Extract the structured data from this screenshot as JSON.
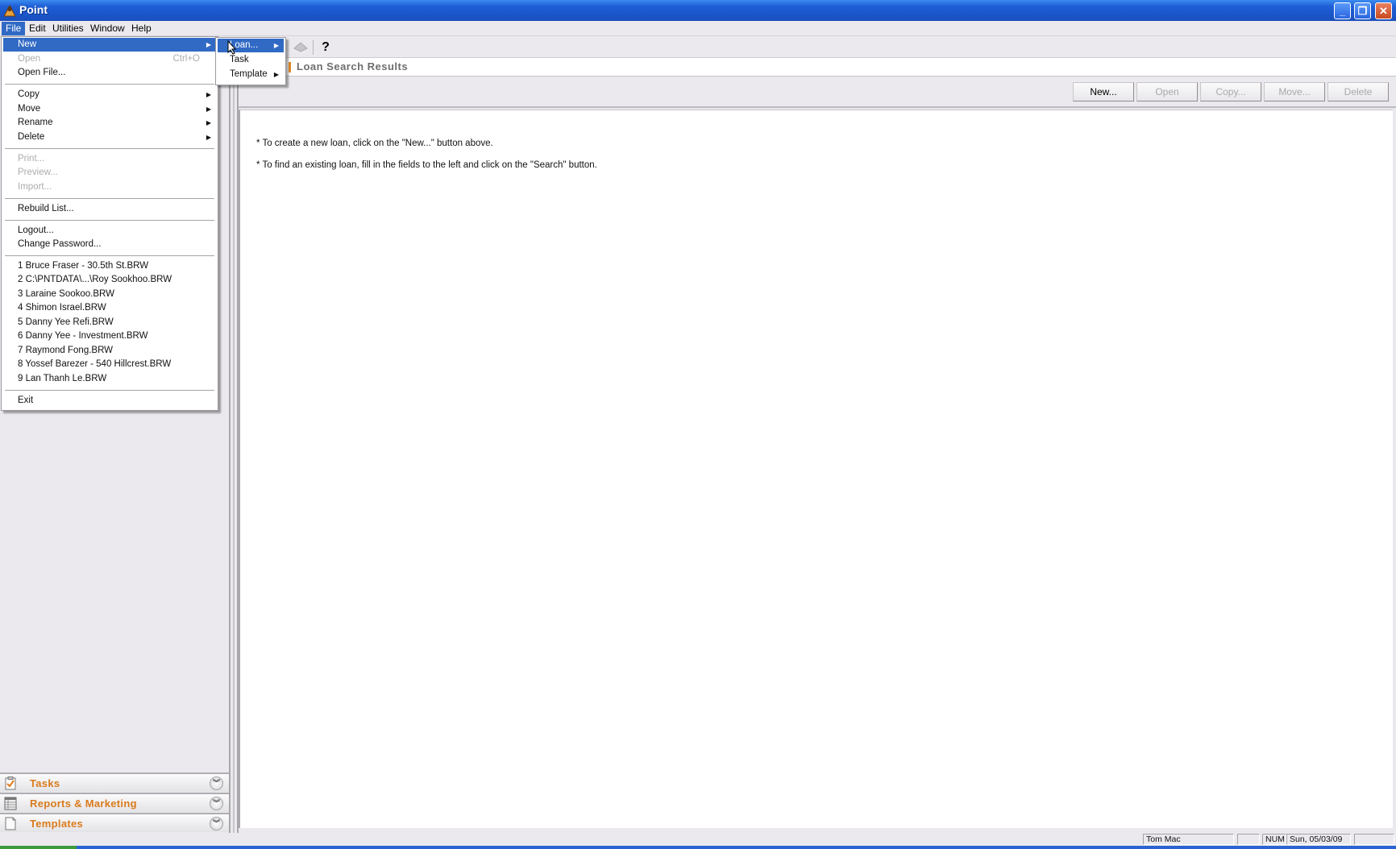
{
  "window": {
    "title": "Point",
    "controls": {
      "minimize": "_",
      "restore": "❐",
      "close": "✕"
    }
  },
  "menubar": {
    "items": [
      "File",
      "Edit",
      "Utilities",
      "Window",
      "Help"
    ],
    "active": "File"
  },
  "file_menu": {
    "new": "New",
    "open": "Open",
    "open_shortcut": "Ctrl+O",
    "open_file": "Open File...",
    "copy": "Copy",
    "move": "Move",
    "rename": "Rename",
    "delete": "Delete",
    "print": "Print...",
    "preview": "Preview...",
    "import": "Import...",
    "rebuild_list": "Rebuild List...",
    "logout": "Logout...",
    "change_password": "Change Password...",
    "recent_files": [
      "1 Bruce Fraser - 30.5th St.BRW",
      "2 C:\\PNTDATA\\...\\Roy Sookhoo.BRW",
      "3 Laraine Sookoo.BRW",
      "4 Shimon Israel.BRW",
      "5 Danny Yee Refi.BRW",
      "6 Danny Yee - Investment.BRW",
      "7 Raymond Fong.BRW",
      "8 Yossef Barezer - 540 Hillcrest.BRW",
      "9 Lan Thanh Le.BRW"
    ],
    "exit": "Exit"
  },
  "new_submenu": {
    "items": [
      "Loan...",
      "Task",
      "Template"
    ],
    "highlighted": "Loan..."
  },
  "toolbar": {
    "help_glyph": "?"
  },
  "heading": {
    "title": "Loan Search Results"
  },
  "actions": {
    "buttons": [
      {
        "label": "New...",
        "enabled": true
      },
      {
        "label": "Open",
        "enabled": false
      },
      {
        "label": "Copy...",
        "enabled": false
      },
      {
        "label": "Move...",
        "enabled": false
      },
      {
        "label": "Delete",
        "enabled": false
      }
    ]
  },
  "content": {
    "lines": [
      "* To create a new loan, click on the \"New...\" button above.",
      "* To find an existing loan, fill in the fields to the left and click on the \"Search\" button."
    ]
  },
  "nav_sections": [
    {
      "label": "Tasks",
      "icon": "clipboard-check-icon"
    },
    {
      "label": "Reports & Marketing",
      "icon": "table-report-icon"
    },
    {
      "label": "Templates",
      "icon": "document-icon"
    }
  ],
  "statusbar": {
    "user": "Tom Mac",
    "num": "NUM",
    "date": "Sun, 05/03/09"
  },
  "colors": {
    "titlebar": "#1f5fd6",
    "menu_highlight": "#316ac5",
    "section_label": "#d97b1c",
    "accent_bar": "#e08a2a"
  }
}
